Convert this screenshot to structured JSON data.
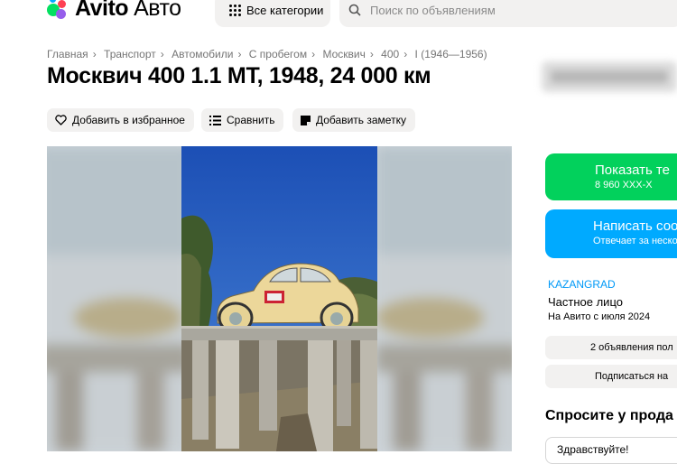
{
  "header": {
    "logo_brand": "Avito",
    "logo_sub": "Авто",
    "categories_label": "Все категории",
    "search_placeholder": "Поиск по объявлениям"
  },
  "breadcrumbs": [
    "Главная",
    "Транспорт",
    "Автомобили",
    "С пробегом",
    "Москвич",
    "400",
    "I (1946—1956)"
  ],
  "listing": {
    "title": "Москвич 400 1.1 MT, 1948, 24 000 км"
  },
  "actions": {
    "favorite_label": "Добавить в избранное",
    "compare_label": "Сравнить",
    "note_label": "Добавить заметку"
  },
  "contact": {
    "show_phone_label": "Показать те",
    "phone_masked": "8 960 XXX-X",
    "write_label": "Написать соо",
    "write_sub": "Отвечает за неско"
  },
  "seller": {
    "name": "KAZANGRAD",
    "type": "Частное лицо",
    "since": "На Авито с июля 2024",
    "listings_label": "2 объявления пол",
    "subscribe_label": "Подписаться на"
  },
  "chat": {
    "title": "Спросите у прода",
    "quick_reply": "Здравствуйте!"
  },
  "icons": {
    "favorite": "heart-icon",
    "compare": "compare-bars-icon",
    "note": "note-icon",
    "search": "search-icon",
    "categories": "grid-dots-icon"
  },
  "colors": {
    "green": "#02d15c",
    "blue": "#00aaff",
    "link": "#0099f7"
  }
}
